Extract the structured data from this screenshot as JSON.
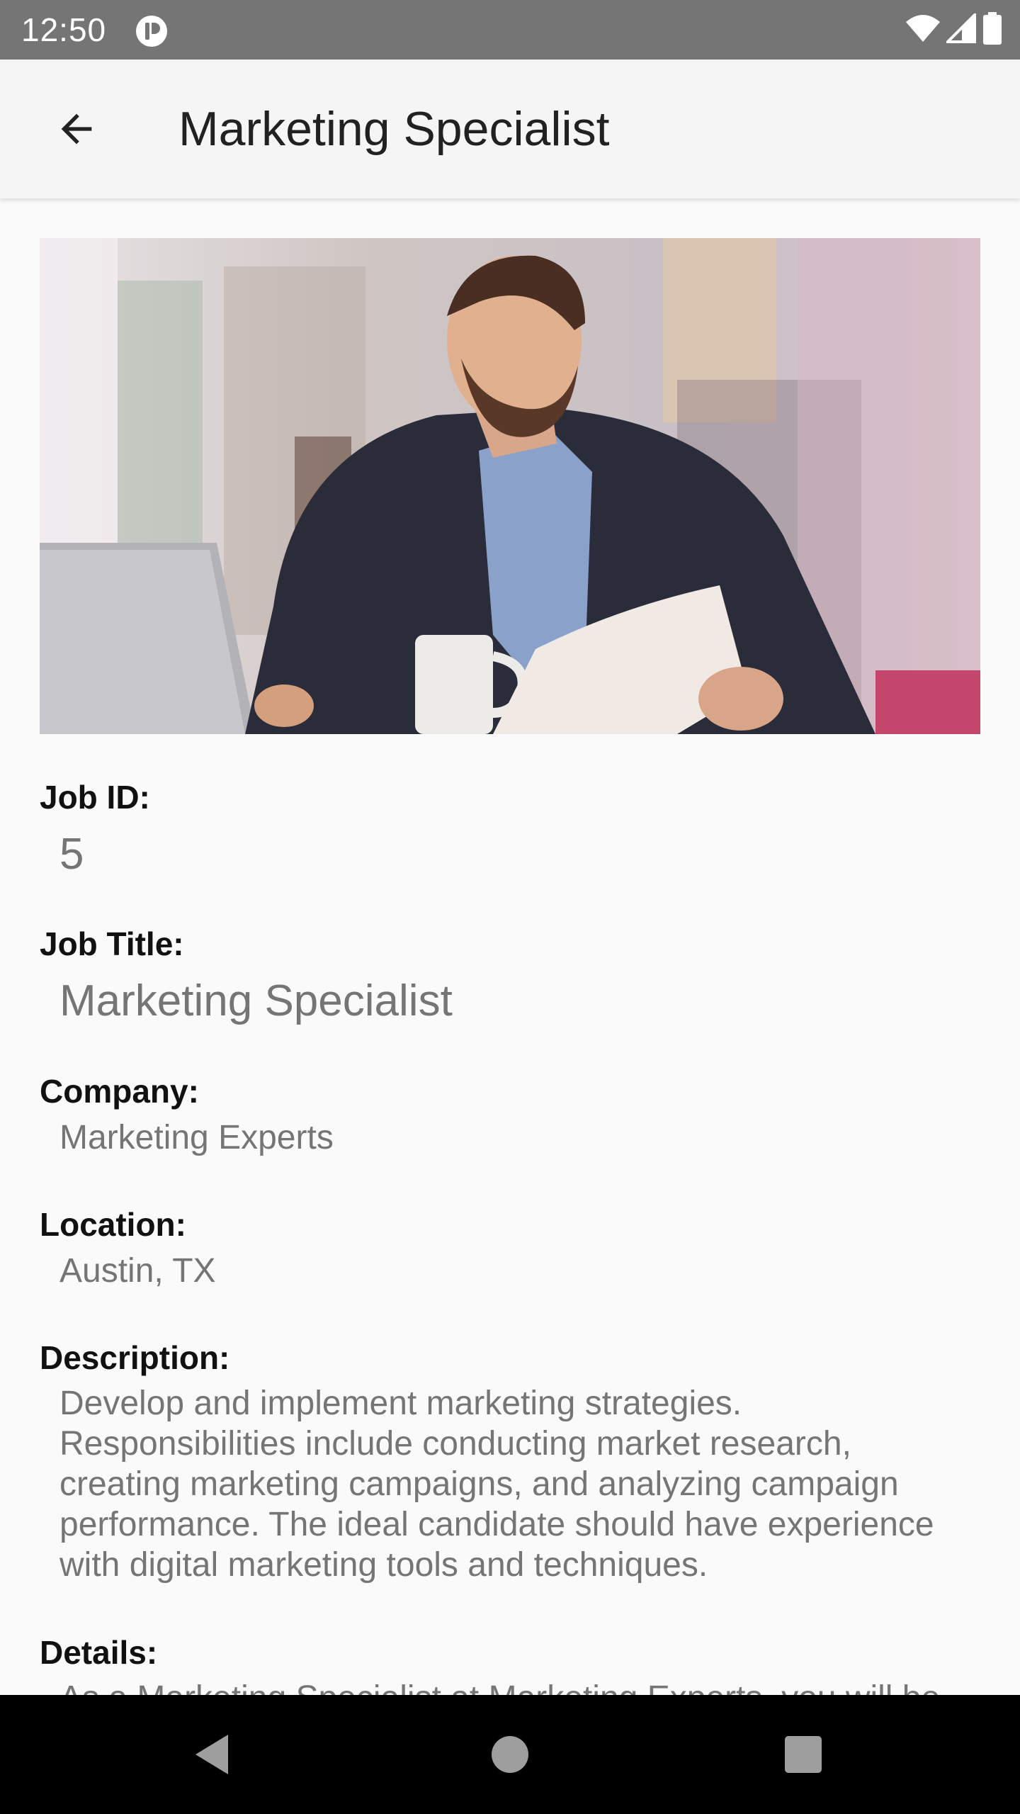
{
  "status_bar": {
    "time": "12:50",
    "icons": [
      "app-notification-icon",
      "wifi-icon",
      "signal-icon",
      "battery-icon"
    ]
  },
  "app_bar": {
    "title": "Marketing Specialist",
    "back_icon": "arrow-back-icon"
  },
  "job": {
    "image_icon": "businessman-with-laptop-photo",
    "id_label": "Job ID:",
    "id_value": "5",
    "title_label": "Job Title:",
    "title_value": "Marketing Specialist",
    "company_label": "Company:",
    "company_value": "Marketing Experts",
    "location_label": "Location:",
    "location_value": "Austin, TX",
    "description_label": "Description:",
    "description_value": "Develop and implement marketing strategies. Responsibilities include conducting market research, creating marketing campaigns, and analyzing campaign performance. The ideal candidate should have experience with digital marketing tools and techniques.",
    "details_label": "Details:",
    "details_value": "As a Marketing Specialist at Marketing Experts, you will be"
  },
  "nav_bar": {
    "icons": [
      "back-triangle-icon",
      "home-circle-icon",
      "recents-square-icon"
    ]
  },
  "colors": {
    "status_bar": "#757575",
    "app_bar": "#f5f5f5",
    "background": "#fafafa",
    "label_text": "#111111",
    "value_text": "#757575",
    "nav_bar": "#000000"
  }
}
